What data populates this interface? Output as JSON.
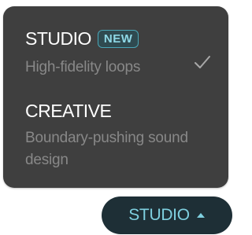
{
  "menu": {
    "options": [
      {
        "title": "STUDIO",
        "badge": "NEW",
        "description": "High-fidelity loops",
        "selected": true
      },
      {
        "title": "CREATIVE",
        "description": "Boundary-pushing sound design",
        "selected": false
      }
    ]
  },
  "trigger": {
    "label": "STUDIO",
    "icon": "caret-up-icon"
  },
  "colors": {
    "menu_background": "#3f3f3f",
    "accent": "#7fd0e0",
    "trigger_background": "#1e2f36",
    "muted_text": "#888888"
  }
}
